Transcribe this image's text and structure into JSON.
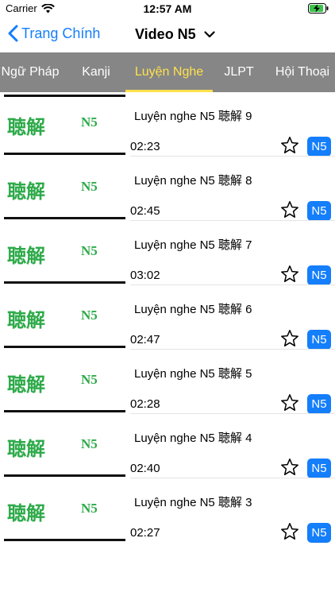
{
  "status_bar": {
    "carrier": "Carrier",
    "time": "12:57 AM"
  },
  "nav": {
    "back_label": "Trang Chính",
    "title": "Video N5"
  },
  "tabs": [
    {
      "label": "Ngữ Pháp",
      "active": false
    },
    {
      "label": "Kanji",
      "active": false
    },
    {
      "label": "Luyện Nghe",
      "active": true
    },
    {
      "label": "JLPT",
      "active": false
    },
    {
      "label": "Hội Thoại",
      "active": false
    }
  ],
  "thumbnail": {
    "kanji": "聴解",
    "level": "N5"
  },
  "items": [
    {
      "title": "Luyện nghe N5 聴解 9",
      "duration": "02:23",
      "badge": "N5"
    },
    {
      "title": "Luyện nghe N5 聴解 8",
      "duration": "02:45",
      "badge": "N5"
    },
    {
      "title": "Luyện nghe N5 聴解 7",
      "duration": "03:02",
      "badge": "N5"
    },
    {
      "title": "Luyện nghe N5 聴解 6",
      "duration": "02:47",
      "badge": "N5"
    },
    {
      "title": "Luyện nghe N5 聴解 5",
      "duration": "02:28",
      "badge": "N5"
    },
    {
      "title": "Luyện nghe N5 聴解 4",
      "duration": "02:40",
      "badge": "N5"
    },
    {
      "title": "Luyện nghe N5 聴解 3",
      "duration": "02:27",
      "badge": "N5"
    }
  ],
  "colors": {
    "accent": "#147efb",
    "tab_bar": "#868686",
    "tab_active": "#ffe14d",
    "thumb_text": "#2eaa4a"
  }
}
